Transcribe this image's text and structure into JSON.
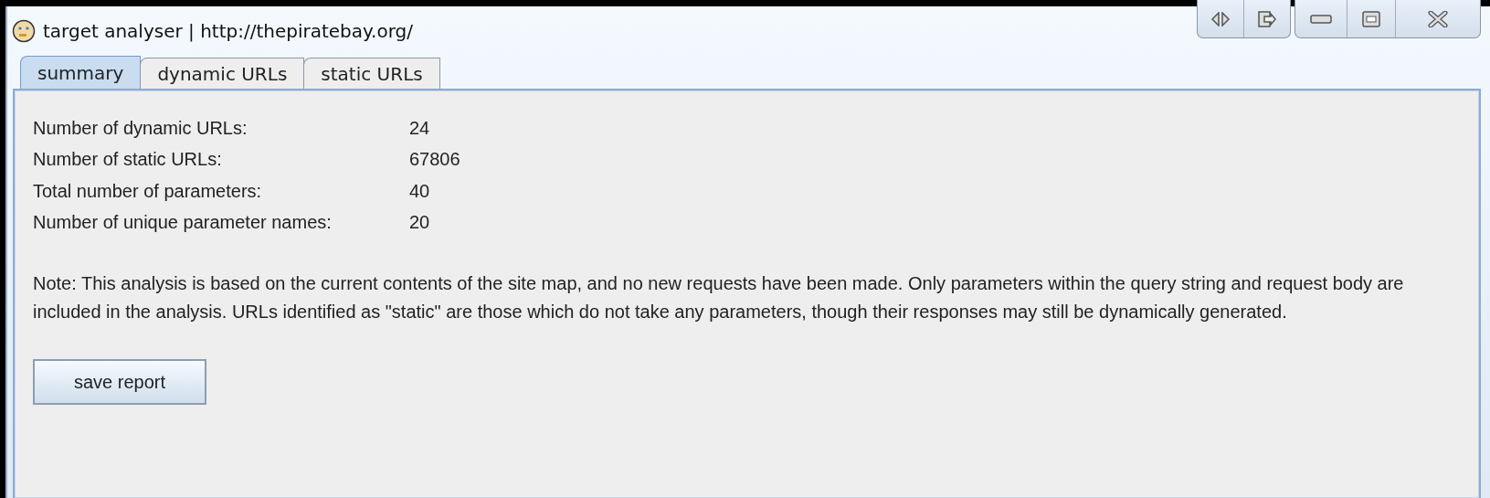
{
  "window": {
    "title": "target analyser | http://thepiratebay.org/"
  },
  "tabs": [
    {
      "label": "summary",
      "selected": true
    },
    {
      "label": "dynamic URLs",
      "selected": false
    },
    {
      "label": "static URLs",
      "selected": false
    }
  ],
  "summary": {
    "rows": [
      {
        "label": "Number of dynamic URLs:",
        "value": "24"
      },
      {
        "label": "Number of static URLs:",
        "value": "67806"
      },
      {
        "label": "Total number of parameters:",
        "value": "40"
      },
      {
        "label": "Number of unique parameter names:",
        "value": "20"
      }
    ],
    "note": "Note: This analysis is based on the current contents of the site map, and no new requests have been made. Only parameters within the query string and request body are included in the analysis. URLs identified as \"static\" are those which do not take any parameters, though their responses may still be dynamically generated.",
    "button": "save report"
  }
}
